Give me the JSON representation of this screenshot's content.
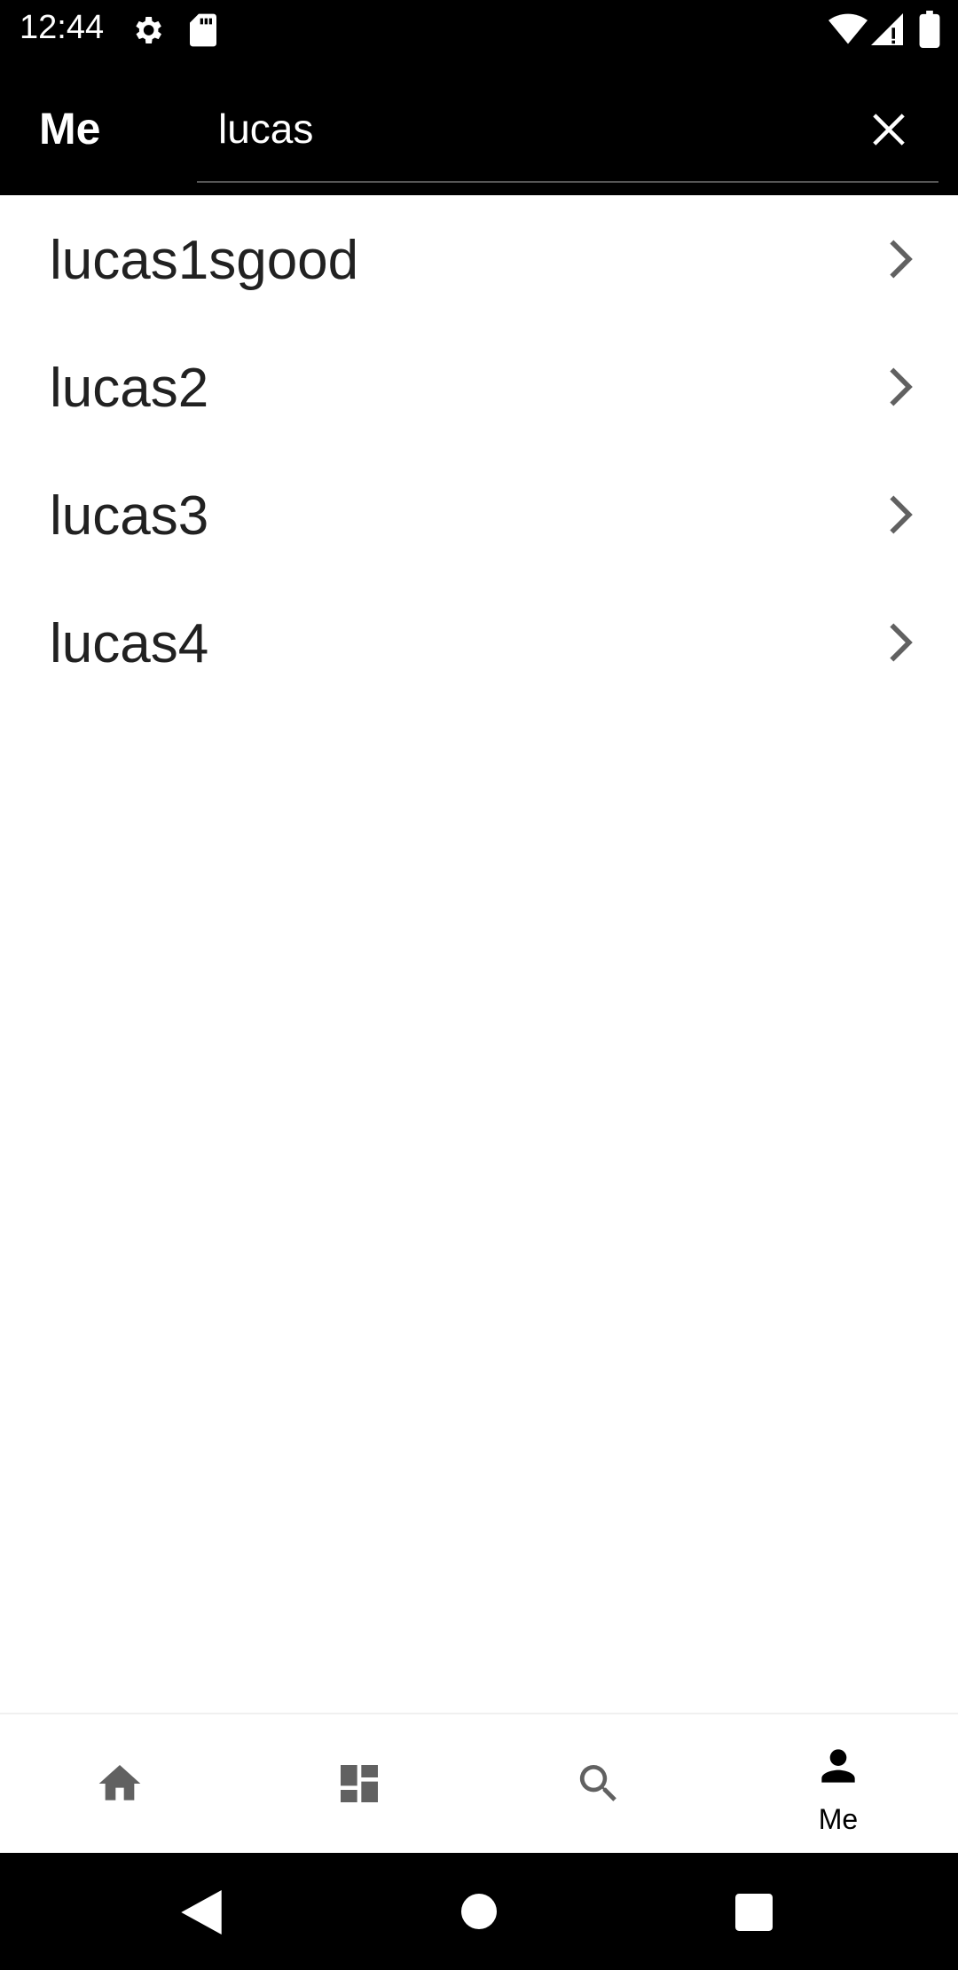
{
  "status_bar": {
    "time": "12:44",
    "icons": [
      "settings-gear-icon",
      "sd-card-icon",
      "wifi-icon",
      "cell-signal-icon",
      "battery-icon"
    ]
  },
  "app_bar": {
    "title": "Me",
    "search": {
      "value": "lucas",
      "clear_icon": "close-icon"
    }
  },
  "results": [
    {
      "label": "lucas1sgood"
    },
    {
      "label": "lucas2"
    },
    {
      "label": "lucas3"
    },
    {
      "label": "lucas4"
    }
  ],
  "bottom_nav": {
    "items": [
      {
        "icon": "home-icon",
        "label": ""
      },
      {
        "icon": "dashboard-icon",
        "label": ""
      },
      {
        "icon": "search-icon",
        "label": ""
      },
      {
        "icon": "person-icon",
        "label": "Me",
        "selected": true
      }
    ]
  },
  "system_nav": [
    "back-icon",
    "home-circle-icon",
    "recents-icon"
  ],
  "colors": {
    "bar_background": "#000000",
    "list_text": "#212121",
    "chevron": "#616161",
    "nav_icon_inactive": "#616161",
    "nav_icon_active": "#000000"
  }
}
